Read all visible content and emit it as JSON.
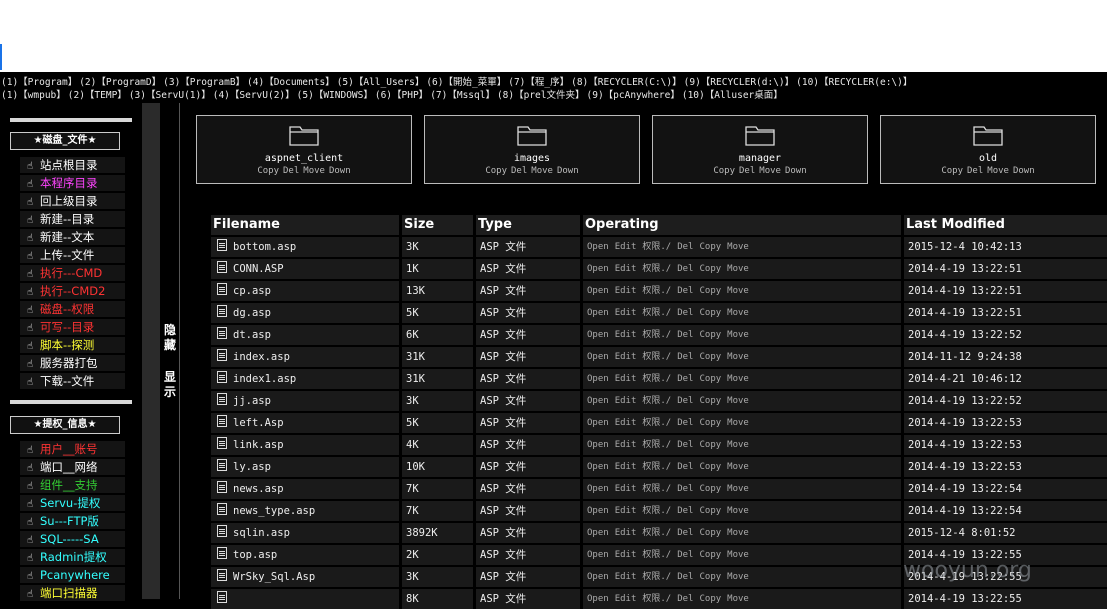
{
  "nav_row1": [
    "(1)【Program】",
    "(2)【ProgramD】",
    "(3)【ProgramB】",
    "(4)【Documents】",
    "(5)【All_Users】",
    "(6)【開始_菜單】",
    "(7)【程_序】",
    "(8)【RECYCLER(C:\\)】",
    "(9)【RECYCLER(d:\\)】",
    "(10)【RECYCLER(e:\\)】"
  ],
  "nav_row2": [
    "(1)【wmpub】",
    "(2)【TEMP】",
    "(3)【ServU(1)】",
    "(4)【ServU(2)】",
    "(5)【WINDOWS】",
    "(6)【PHP】",
    "(7)【Mssql】",
    "(8)【prel文件夹】",
    "(9)【pcAnywhere】",
    "(10)【Alluser桌面】"
  ],
  "sidebar": {
    "section1_title": "★磁盘_文件★",
    "section1_items": [
      {
        "label": "站点根目录",
        "color": "#ffffff"
      },
      {
        "label": "本程序目录",
        "color": "#ff44ff"
      },
      {
        "label": "回上级目录",
        "color": "#ffffff"
      },
      {
        "label": "新建--目录",
        "color": "#ffffff"
      },
      {
        "label": "新建--文本",
        "color": "#ffffff"
      },
      {
        "label": "上传--文件",
        "color": "#ffffff"
      },
      {
        "label": "执行---CMD",
        "color": "#ff3333"
      },
      {
        "label": "执行--CMD2",
        "color": "#ff3333"
      },
      {
        "label": "磁盘--权限",
        "color": "#ff3333"
      },
      {
        "label": "可写--目录",
        "color": "#ff3333"
      },
      {
        "label": "脚本--探测",
        "color": "#ffff33"
      },
      {
        "label": "服务器打包",
        "color": "#ffffff"
      },
      {
        "label": "下载--文件",
        "color": "#ffffff"
      }
    ],
    "section2_title": "★提权_信息★",
    "section2_items": [
      {
        "label": "用户__账号",
        "color": "#ff3333"
      },
      {
        "label": "端口__网络",
        "color": "#ffffff"
      },
      {
        "label": "组件__支持",
        "color": "#33cc33"
      },
      {
        "label": "Servu-提权",
        "color": "#33ffff"
      },
      {
        "label": "Su---FTP版",
        "color": "#33ffff"
      },
      {
        "label": "SQL-----SA",
        "color": "#33ffff"
      },
      {
        "label": "Radmin提权",
        "color": "#33ffff"
      },
      {
        "label": "Pcanywhere",
        "color": "#33ffff"
      },
      {
        "label": "端口扫描器",
        "color": "#ffff33"
      }
    ],
    "hide_label": "隐藏",
    "show_label": "显示"
  },
  "folders": [
    {
      "name": "aspnet_client"
    },
    {
      "name": "images"
    },
    {
      "name": "manager"
    },
    {
      "name": "old"
    }
  ],
  "folder_ops": [
    "Copy",
    "Del",
    "Move",
    "Down"
  ],
  "table": {
    "headers": [
      "Filename",
      "Size",
      "Type",
      "Operating",
      "Last Modified"
    ],
    "ops": [
      "Open",
      "Edit",
      "权限./",
      "Del",
      "Copy",
      "Move"
    ],
    "rows": [
      {
        "name": "bottom.asp",
        "size": "3K",
        "type": "ASP 文件",
        "date": "2015-12-4 10:42:13"
      },
      {
        "name": "CONN.ASP",
        "size": "1K",
        "type": "ASP 文件",
        "date": "2014-4-19 13:22:51"
      },
      {
        "name": "cp.asp",
        "size": "13K",
        "type": "ASP 文件",
        "date": "2014-4-19 13:22:51"
      },
      {
        "name": "dg.asp",
        "size": "5K",
        "type": "ASP 文件",
        "date": "2014-4-19 13:22:51"
      },
      {
        "name": "dt.asp",
        "size": "6K",
        "type": "ASP 文件",
        "date": "2014-4-19 13:22:52"
      },
      {
        "name": "index.asp",
        "size": "31K",
        "type": "ASP 文件",
        "date": "2014-11-12 9:24:38"
      },
      {
        "name": "index1.asp",
        "size": "31K",
        "type": "ASP 文件",
        "date": "2014-4-21 10:46:12"
      },
      {
        "name": "jj.asp",
        "size": "3K",
        "type": "ASP 文件",
        "date": "2014-4-19 13:22:52"
      },
      {
        "name": "left.Asp",
        "size": "5K",
        "type": "ASP 文件",
        "date": "2014-4-19 13:22:53"
      },
      {
        "name": "link.asp",
        "size": "4K",
        "type": "ASP 文件",
        "date": "2014-4-19 13:22:53"
      },
      {
        "name": "ly.asp",
        "size": "10K",
        "type": "ASP 文件",
        "date": "2014-4-19 13:22:53"
      },
      {
        "name": "news.asp",
        "size": "7K",
        "type": "ASP 文件",
        "date": "2014-4-19 13:22:54"
      },
      {
        "name": "news_type.asp",
        "size": "7K",
        "type": "ASP 文件",
        "date": "2014-4-19 13:22:54"
      },
      {
        "name": "sqlin.asp",
        "size": "3892K",
        "type": "ASP 文件",
        "date": "2015-12-4 8:01:52"
      },
      {
        "name": "top.asp",
        "size": "2K",
        "type": "ASP 文件",
        "date": "2014-4-19 13:22:55"
      },
      {
        "name": "WrSky_Sql.Asp",
        "size": "3K",
        "type": "ASP 文件",
        "date": "2014-4-19 13:22:55"
      },
      {
        "name": "",
        "size": "8K",
        "type": "ASP 文件",
        "date": "2014-4-19 13:22:55"
      }
    ]
  },
  "watermark": "wooyun.org"
}
